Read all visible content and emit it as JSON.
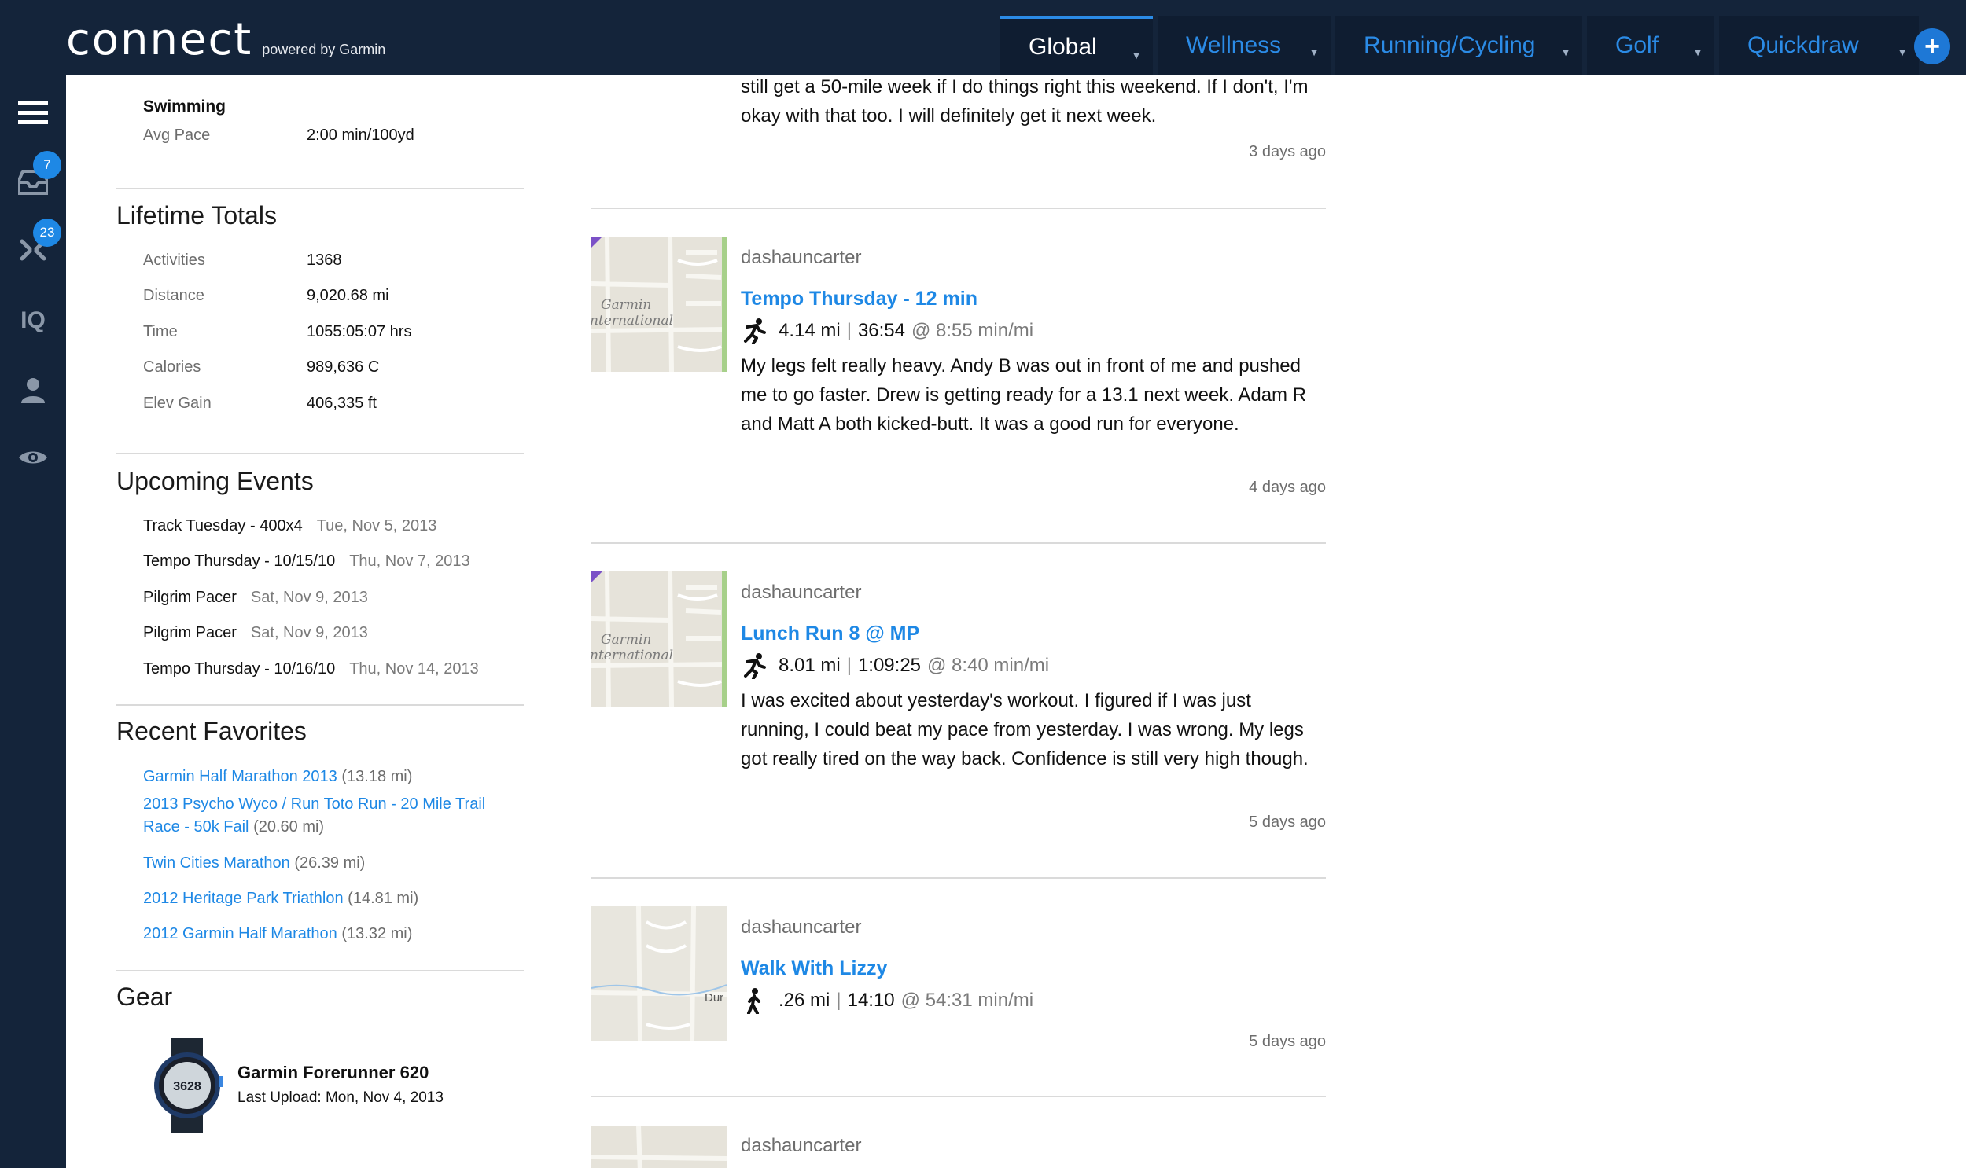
{
  "header": {
    "logo_word": "connect",
    "logo_sub": "powered by Garmin",
    "tabs": [
      {
        "label": "Global",
        "active": true
      },
      {
        "label": "Wellness",
        "active": false
      },
      {
        "label": "Running/Cycling",
        "active": false
      },
      {
        "label": "Golf",
        "active": false
      },
      {
        "label": "Quickdraw",
        "active": false
      }
    ],
    "add_label": "+"
  },
  "rail": {
    "items": [
      "menu-icon",
      "inbox-icon",
      "connections-icon",
      "iq-icon",
      "profile-icon",
      "eye-icon"
    ],
    "inbox_badge": "7",
    "connections_badge": "23",
    "iq_label": "IQ"
  },
  "personal_records": {
    "swimming_title": "Swimming",
    "avg_pace_label": "Avg Pace",
    "avg_pace_value": "2:00 min/100yd"
  },
  "lifetime_totals": {
    "title": "Lifetime Totals",
    "rows": [
      {
        "label": "Activities",
        "value": "1368"
      },
      {
        "label": "Distance",
        "value": "9,020.68 mi"
      },
      {
        "label": "Time",
        "value": "1055:05:07 hrs"
      },
      {
        "label": "Calories",
        "value": "989,636 C"
      },
      {
        "label": "Elev Gain",
        "value": "406,335 ft"
      }
    ]
  },
  "upcoming_events": {
    "title": "Upcoming Events",
    "rows": [
      {
        "name": "Track Tuesday - 400x4",
        "date": "Tue, Nov 5, 2013"
      },
      {
        "name": "Tempo Thursday - 10/15/10",
        "date": "Thu, Nov 7, 2013"
      },
      {
        "name": "Pilgrim Pacer",
        "date": "Sat, Nov 9, 2013"
      },
      {
        "name": "Pilgrim Pacer",
        "date": "Sat, Nov 9, 2013"
      },
      {
        "name": "Tempo Thursday - 10/16/10",
        "date": "Thu, Nov 14, 2013"
      }
    ]
  },
  "recent_favorites": {
    "title": "Recent Favorites",
    "rows": [
      {
        "name": "Garmin Half Marathon 2013",
        "distance": "(13.18 mi)"
      },
      {
        "name": "2013 Psycho Wyco / Run Toto Run - 20 Mile Trail Race - 50k Fail",
        "distance": "(20.60 mi)"
      },
      {
        "name": "Twin Cities Marathon",
        "distance": "(26.39 mi)"
      },
      {
        "name": "2012 Heritage Park Triathlon",
        "distance": "(14.81 mi)"
      },
      {
        "name": "2012 Garmin Half Marathon",
        "distance": "(13.32 mi)"
      }
    ]
  },
  "gear": {
    "title": "Gear",
    "name": "Garmin Forerunner 620",
    "last_upload": "Last Upload: Mon, Nov 4, 2013",
    "watch_face": "3628"
  },
  "feed": {
    "top_text": "still get a 50-mile week if I do things right this weekend. If I don't, I'm okay with that too. I will definitely get it next week.",
    "top_ago": "3 days ago",
    "map_text_1": "Garmin",
    "map_text_2": "nternational",
    "map_text_3": "Dur",
    "items": [
      {
        "user": "dashauncarter",
        "title": "Tempo Thursday - 12 min",
        "distance": "4.14 mi",
        "time": "36:54",
        "pace": "@ 8:55 min/mi",
        "icon": "running-icon",
        "text": "My legs felt really heavy. Andy B was out in front of me and pushed me to go faster. Drew is getting ready for a 13.1 next week. Adam R and Matt A both kicked-butt. It was a good run for everyone.",
        "ago": "4 days ago"
      },
      {
        "user": "dashauncarter",
        "title": "Lunch Run 8 @ MP",
        "distance": "8.01 mi",
        "time": "1:09:25",
        "pace": "@ 8:40 min/mi",
        "icon": "running-icon",
        "text": "I was excited about yesterday's workout. I figured if I was just running, I could beat my pace from yesterday. I was wrong. My legs got really tired on the way back. Confidence is still very high though.",
        "ago": "5 days ago"
      },
      {
        "user": "dashauncarter",
        "title": "Walk With Lizzy",
        "distance": ".26 mi",
        "time": "14:10",
        "pace": "@ 54:31 min/mi",
        "icon": "walking-icon",
        "text": "",
        "ago": "5 days ago"
      },
      {
        "user": "dashauncarter"
      }
    ]
  },
  "colors": {
    "nav_bg": "#14243a",
    "accent": "#1e88e5",
    "muted": "#6d6d6d"
  }
}
